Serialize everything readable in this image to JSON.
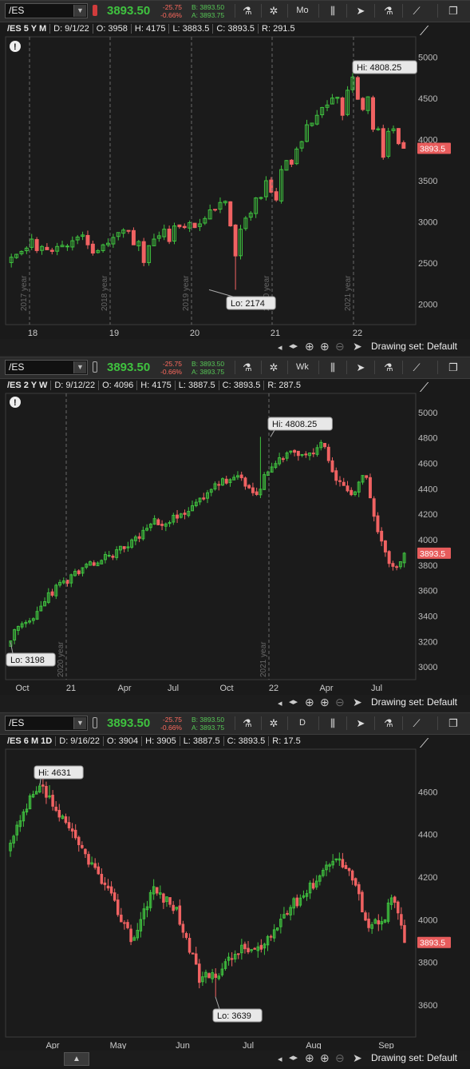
{
  "symbol": "/ES",
  "last": "3893.50",
  "change": "-25.75",
  "change_pct": "-0.66%",
  "bid": "B: 3893.50",
  "ask": "A: 3893.75",
  "drawing_set": "Drawing set: Default",
  "colors": {
    "up": "#3fc23f",
    "down": "#f06262",
    "price_tag": "#e85c5c"
  },
  "panels": [
    {
      "id": "five-year-monthly",
      "aggregation": "Mo",
      "info": {
        "symbol": "/ES 5 Y M",
        "date": "D: 9/1/22",
        "open": "O: 3958",
        "high": "H: 4175",
        "low": "L: 3883.5",
        "close": "C: 3893.5",
        "range": "R: 291.5"
      },
      "price_tag": "3893.5",
      "hi_label": "Hi: 4808.25",
      "lo_label": "Lo: 2174"
    },
    {
      "id": "two-year-weekly",
      "aggregation": "Wk",
      "info": {
        "symbol": "/ES 2 Y W",
        "date": "D: 9/12/22",
        "open": "O: 4096",
        "high": "H: 4175",
        "low": "L: 3887.5",
        "close": "C: 3893.5",
        "range": "R: 287.5"
      },
      "price_tag": "3893.5",
      "hi_label": "Hi: 4808.25",
      "lo_label": "Lo: 3198"
    },
    {
      "id": "six-month-daily",
      "aggregation": "D",
      "info": {
        "symbol": "/ES 6 M 1D",
        "date": "D: 9/16/22",
        "open": "O: 3904",
        "high": "H: 3905",
        "low": "L: 3887.5",
        "close": "C: 3893.5",
        "range": "R: 17.5"
      },
      "price_tag": "3893.5",
      "hi_label": "Hi: 4631",
      "lo_label": "Lo: 3639"
    }
  ],
  "chart_data": [
    {
      "type": "candlestick",
      "ylim": [
        1750,
        5250
      ],
      "yticks": [
        2000,
        2500,
        3000,
        3500,
        4000,
        4500,
        5000
      ],
      "xticks": [
        "18",
        "19",
        "20",
        "21",
        "22"
      ],
      "period_lines": [
        "2017 year",
        "2018 year",
        "2019 year",
        "2020 year",
        "2021 year"
      ],
      "closes": [
        2570,
        2605,
        2640,
        2680,
        2790,
        2650,
        2700,
        2660,
        2640,
        2700,
        2715,
        2705,
        2770,
        2815,
        2840,
        2720,
        2620,
        2650,
        2720,
        2740,
        2810,
        2870,
        2900,
        2885,
        2720,
        2760,
        2505,
        2710,
        2790,
        2830,
        2910,
        2760,
        2950,
        2940,
        2930,
        2990,
        2930,
        2975,
        3040,
        3145,
        3150,
        3235,
        3250,
        2950,
        2585,
        2910,
        3045,
        3105,
        3290,
        3295,
        3500,
        3360,
        3265,
        3635,
        3745,
        3700,
        3885,
        3975,
        4180,
        4200,
        4295,
        4390,
        4420,
        4505,
        4515,
        4295,
        4600,
        4760,
        4490,
        4365,
        4520,
        4125,
        4130,
        3785,
        4100,
        4130,
        3950,
        3893.5
      ],
      "hi": 4808.25,
      "lo": 2174
    },
    {
      "type": "candlestick",
      "ylim": [
        2900,
        5150
      ],
      "yticks": [
        3000,
        3200,
        3400,
        3600,
        3800,
        4000,
        4200,
        4400,
        4600,
        4800,
        5000
      ],
      "xticks": [
        "Oct",
        "21",
        "Apr",
        "Jul",
        "Oct",
        "22",
        "Apr",
        "Jul"
      ],
      "period_lines": [
        "2020 year",
        "2021 year"
      ],
      "hi": 4808.25,
      "lo": 3198
    },
    {
      "type": "candlestick",
      "ylim": [
        3450,
        4800
      ],
      "yticks": [
        3600,
        3800,
        4000,
        4200,
        4400,
        4600
      ],
      "xticks": [
        "Apr",
        "May",
        "Jun",
        "Jul",
        "Aug",
        "Sep"
      ],
      "hi": 4631,
      "lo": 3639
    }
  ]
}
